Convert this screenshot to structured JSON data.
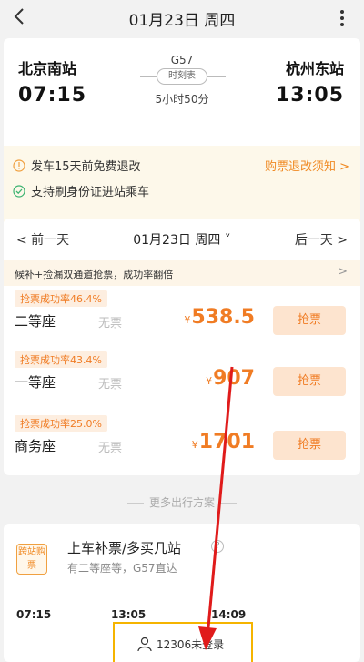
{
  "header": {
    "title": "01月23日 周四"
  },
  "train": {
    "dep_station": "北京南站",
    "arr_station": "杭州东站",
    "dep_time": "07:15",
    "arr_time": "13:05",
    "train_no": "G57",
    "timetable_label": "时刻表",
    "duration": "5小时50分"
  },
  "notices": {
    "refund": "发车15天前免费退改",
    "id_card": "支持刷身份证进站乘车",
    "link": "购票退改须知 >"
  },
  "date_nav": {
    "prev": "< 前一天",
    "current": "01月23日 周四 ˅",
    "next": "后一天 >"
  },
  "promo": {
    "text": "候补+捡漏双通道抢票，成功率翻倍",
    "arrow": ">"
  },
  "seats": [
    {
      "badge": "抢票成功率46.4%",
      "name": "二等座",
      "status": "无票",
      "currency": "¥",
      "price": "538.5",
      "button": "抢票"
    },
    {
      "badge": "抢票成功率43.4%",
      "name": "一等座",
      "status": "无票",
      "currency": "¥",
      "price": "907",
      "button": "抢票"
    },
    {
      "badge": "抢票成功率25.0%",
      "name": "商务座",
      "status": "无票",
      "currency": "¥",
      "price": "1701",
      "button": "抢票"
    }
  ],
  "more_plans": {
    "title": "更多出行方案",
    "badge": "跨站购票",
    "plan_title": "上车补票/多买几站",
    "plan_sub": "有二等座等，G57直达",
    "times": [
      "07:15",
      "13:05",
      "14:09"
    ]
  },
  "bottom": {
    "login": "12306未登录"
  },
  "colors": {
    "accent": "#f07c24",
    "arrow": "#e01b1b",
    "highlight": "#f5b400"
  }
}
